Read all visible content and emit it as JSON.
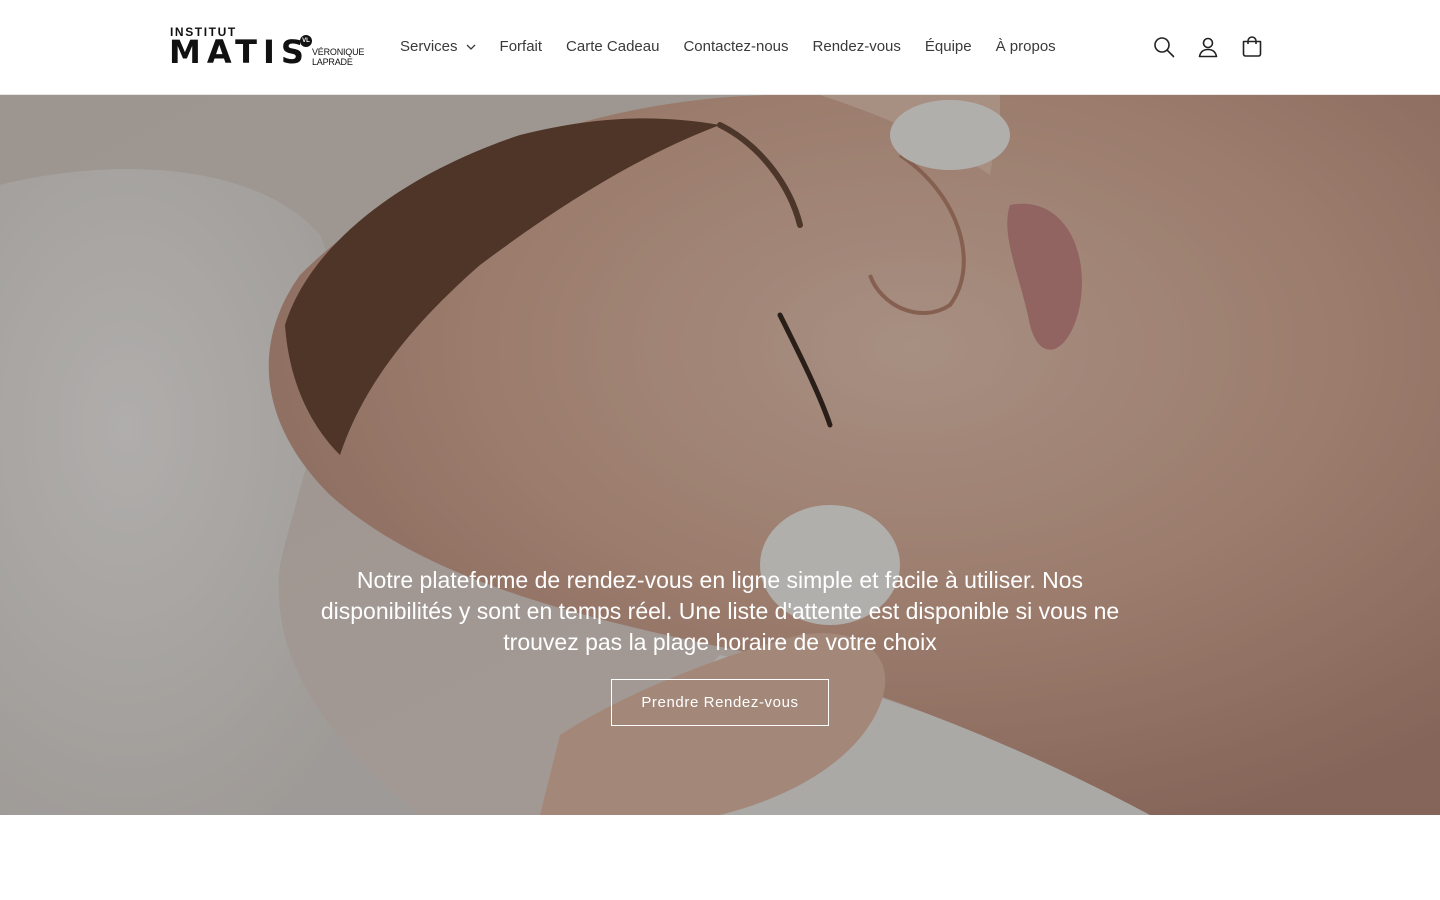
{
  "brand": {
    "small_label": "INSTITUT",
    "name": "MATIS",
    "badge": "VL",
    "subtitle_line1": "VÉRONIQUE",
    "subtitle_line2": "LAPRADE"
  },
  "nav": {
    "items": [
      {
        "label": "Services",
        "has_dropdown": true
      },
      {
        "label": "Forfait"
      },
      {
        "label": "Carte Cadeau"
      },
      {
        "label": "Contactez-nous"
      },
      {
        "label": "Rendez-vous"
      },
      {
        "label": "Équipe"
      },
      {
        "label": "À propos"
      }
    ]
  },
  "header_icons": [
    "search-icon",
    "account-icon",
    "cart-icon"
  ],
  "hero": {
    "text": "Notre plateforme de rendez-vous en ligne simple et facile à utiliser. Nos disponibilités y sont en temps réel. Une liste d'attente est disponible si vous ne trouvez pas la plage horaire de votre choix",
    "button_label": "Prendre Rendez-vous"
  },
  "colors": {
    "text": "#121212",
    "nav_text": "#3a3a3a",
    "hero_text": "#ffffff",
    "background": "#ffffff"
  }
}
